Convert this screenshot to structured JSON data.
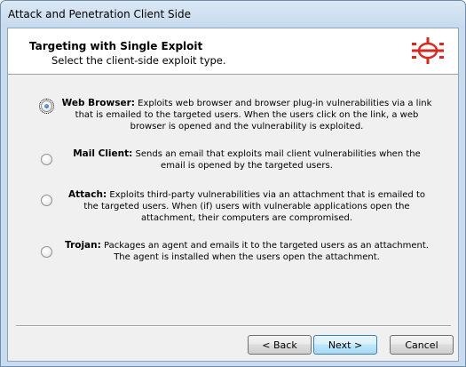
{
  "window": {
    "title": "Attack and Penetration Client Side"
  },
  "header": {
    "title": "Targeting with Single Exploit",
    "subtitle": "Select the client-side exploit type.",
    "logo_icon": "red-target-logo-icon"
  },
  "options": [
    {
      "name": "Web Browser:",
      "description": "Exploits web browser and browser plug-in vulnerabilities via a link that is emailed to the targeted users. When the users click on the link, a web browser is opened and the vulnerability is exploited.",
      "selected": true
    },
    {
      "name": "Mail Client:",
      "description": "Sends an email that exploits mail client vulnerabilities when the email is opened by the targeted users.",
      "selected": false
    },
    {
      "name": "Attach:",
      "description": "Exploits third-party vulnerabilities via an attachment that is emailed to the targeted users. When (if) users with vulnerable applications open the attachment, their computers are compromised.",
      "selected": false
    },
    {
      "name": "Trojan:",
      "description": "Packages an agent and emails it to the targeted users as an attachment. The agent is installed when the users open the attachment.",
      "selected": false
    }
  ],
  "buttons": {
    "back": "< Back",
    "next": "Next >",
    "cancel": "Cancel"
  },
  "colors": {
    "window_frame": "#c9dcef",
    "logo_red": "#d42a20",
    "default_button": "#bee6fd"
  }
}
